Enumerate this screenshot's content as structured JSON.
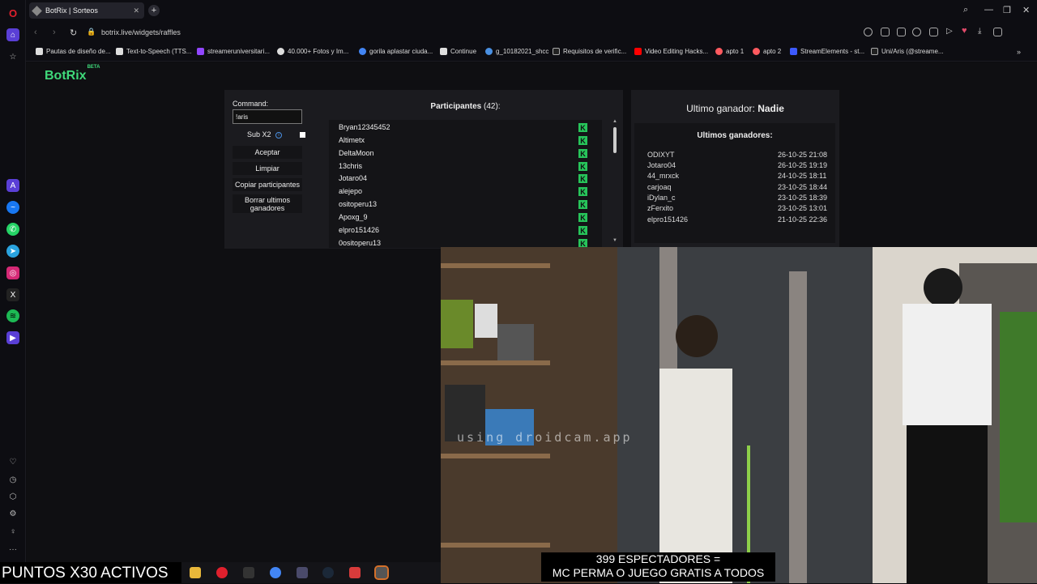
{
  "browser": {
    "tab_title": "BotRix | Sorteos",
    "new_tab_label": "+",
    "url": "botrix.live/widgets/raffles",
    "bookmarks": [
      "Pautas de diseño de...",
      "Text-to-Speech (TTS...",
      "streameruniversitari...",
      "40.000+ Fotos y Im...",
      "gorila aplastar ciuda...",
      "Continue",
      "g_10182021_shcc",
      "Requisitos de verific...",
      "Video Editing Hacks...",
      "apto 1",
      "apto 2",
      "StreamElements - st...",
      "Uni/Aris (@streame..."
    ]
  },
  "app": {
    "logo": "BotRix",
    "logo_badge": "BETA"
  },
  "raffle": {
    "command_label": "Command:",
    "command_value": "!aris",
    "sub_label": "Sub X2",
    "accept_button": "Aceptar",
    "clear_button": "Limpiar",
    "copy_button": "Copiar participantes",
    "delete_button": "Borrar ultimos ganadores",
    "participants_title": "Participantes",
    "participants_count": "(42):",
    "participants": [
      "Bryan12345452",
      "Altimetx",
      "DeltaMoon",
      "13chris",
      "Jotaro04",
      "alejepo",
      "ositoperu13",
      "Apoxg_9",
      "elpro151426",
      "0ositoperu13"
    ]
  },
  "winners": {
    "last_winner_label": "Ultimo ganador:",
    "last_winner_value": "Nadie",
    "history_title": "Ultimos ganadores:",
    "history": [
      {
        "name": "ODIXYT",
        "date": "26-10-25 21:08"
      },
      {
        "name": "Jotaro04",
        "date": "26-10-25 19:19"
      },
      {
        "name": "44_mrxck",
        "date": "24-10-25 18:11"
      },
      {
        "name": "carjoaq",
        "date": "23-10-25 18:44"
      },
      {
        "name": "iDylan_c",
        "date": "23-10-25 18:39"
      },
      {
        "name": "zFerxito",
        "date": "23-10-25 13:01"
      },
      {
        "name": "elpro151426",
        "date": "21-10-25 22:36"
      }
    ]
  },
  "overlay": {
    "puntos": "PUNTOS X30 ACTIVOS",
    "caption_line1": "399 ESPECTADORES =",
    "caption_line2": "MC PERMA O JUEGO GRATIS A TODOS",
    "watermark": "using droidcam.app"
  },
  "colors": {
    "accent_green": "#3fd97a",
    "kick_green": "#27c45a",
    "opera_red": "#e0202d"
  }
}
